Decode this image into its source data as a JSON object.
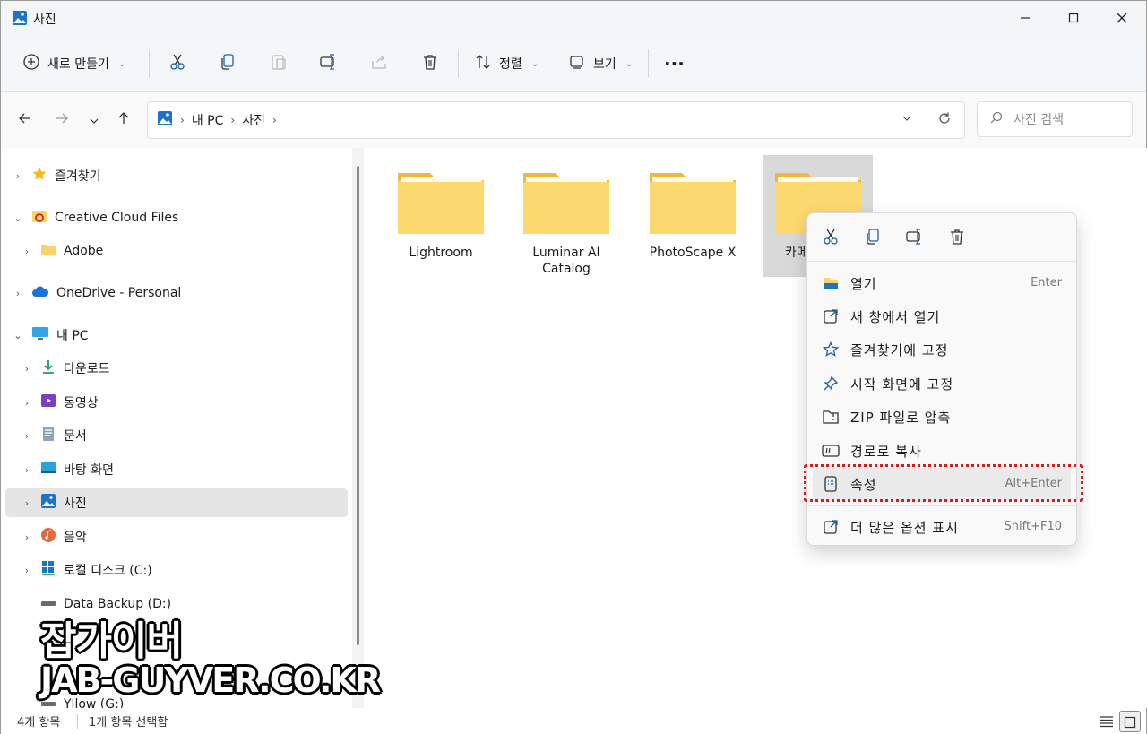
{
  "window": {
    "title": "사진"
  },
  "toolbar": {
    "new_label": "새로 만들기",
    "sort_label": "정렬",
    "view_label": "보기",
    "more_label": "..."
  },
  "address": {
    "crumbs": [
      "내 PC",
      "사진"
    ],
    "search_placeholder": "사진 검색"
  },
  "sidebar": {
    "items": [
      {
        "label": "즐겨찾기",
        "icon": "star-icon"
      },
      {
        "label": "Creative Cloud Files",
        "icon": "creative-cloud-icon"
      },
      {
        "label": "Adobe",
        "icon": "folder-icon"
      },
      {
        "label": "OneDrive - Personal",
        "icon": "cloud-icon"
      },
      {
        "label": "내 PC",
        "icon": "pc-icon"
      },
      {
        "label": "다운로드",
        "icon": "download-icon"
      },
      {
        "label": "동영상",
        "icon": "video-icon"
      },
      {
        "label": "문서",
        "icon": "document-icon"
      },
      {
        "label": "바탕 화면",
        "icon": "desktop-icon"
      },
      {
        "label": "사진",
        "icon": "pictures-icon"
      },
      {
        "label": "음악",
        "icon": "music-icon"
      },
      {
        "label": "로컬 디스크 (C:)",
        "icon": "disk-icon"
      },
      {
        "label": "Data Backup (D:)",
        "icon": "drive-icon"
      },
      {
        "label": "Yllow (G:)",
        "icon": "drive-icon"
      }
    ]
  },
  "folders": [
    {
      "name": "Lightroom"
    },
    {
      "name": "Luminar AI Catalog"
    },
    {
      "name": "PhotoScape X"
    },
    {
      "name": "카메"
    }
  ],
  "context_menu": {
    "items": [
      {
        "label": "열기",
        "shortcut": "Enter",
        "icon": "open-icon"
      },
      {
        "label": "새 창에서 열기",
        "shortcut": "",
        "icon": "new-window-icon"
      },
      {
        "label": "즐겨찾기에 고정",
        "shortcut": "",
        "icon": "star-outline-icon"
      },
      {
        "label": "시작 화면에 고정",
        "shortcut": "",
        "icon": "pin-icon"
      },
      {
        "label": "ZIP 파일로 압축",
        "shortcut": "",
        "icon": "zip-icon"
      },
      {
        "label": "경로로 복사",
        "shortcut": "",
        "icon": "copy-path-icon"
      },
      {
        "label": "속성",
        "shortcut": "Alt+Enter",
        "icon": "properties-icon"
      },
      {
        "label": "더 많은 옵션 표시",
        "shortcut": "Shift+F10",
        "icon": "more-options-icon"
      }
    ]
  },
  "status": {
    "count": "4개 항목",
    "selected": "1개 항목 선택함"
  },
  "watermark": {
    "line1": "잡가이버",
    "line2": "JAB-GUYVER.CO.KR"
  },
  "colors": {
    "folder_yellow": "#f8d36a",
    "highlight_red": "#e01818",
    "selection_gray": "#d9d9d9"
  }
}
